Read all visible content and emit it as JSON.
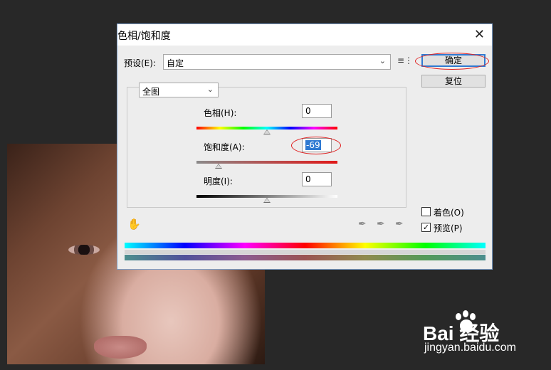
{
  "dialog": {
    "title": "色相/饱和度",
    "close_glyph": "✕"
  },
  "preset": {
    "label": "预设(E):",
    "value": "自定",
    "menu_icon": "preset-options-icon"
  },
  "buttons": {
    "ok": "确定",
    "reset": "复位"
  },
  "channel": {
    "value": "全图"
  },
  "adjustments": {
    "hue": {
      "label": "色相(H):",
      "value": "0",
      "level": 0
    },
    "saturation": {
      "label": "饱和度(A):",
      "value": "-69",
      "level": -69
    },
    "lightness": {
      "label": "明度(I):",
      "value": "0",
      "level": 0
    }
  },
  "options": {
    "colorize": {
      "label": "着色(O)",
      "checked": false
    },
    "preview": {
      "label": "预览(P)",
      "checked": true,
      "check_glyph": "✓"
    }
  },
  "tools": {
    "hand_icon": "hand-adjust-icon",
    "eyedroppers": [
      "eyedropper-icon",
      "eyedropper-plus-icon",
      "eyedropper-minus-icon"
    ]
  },
  "watermark": {
    "brand": "Bai  经验",
    "site": "jingyan.baidu.com"
  },
  "colors": {
    "highlight": "#e02020",
    "selection": "#2f7ad2"
  }
}
